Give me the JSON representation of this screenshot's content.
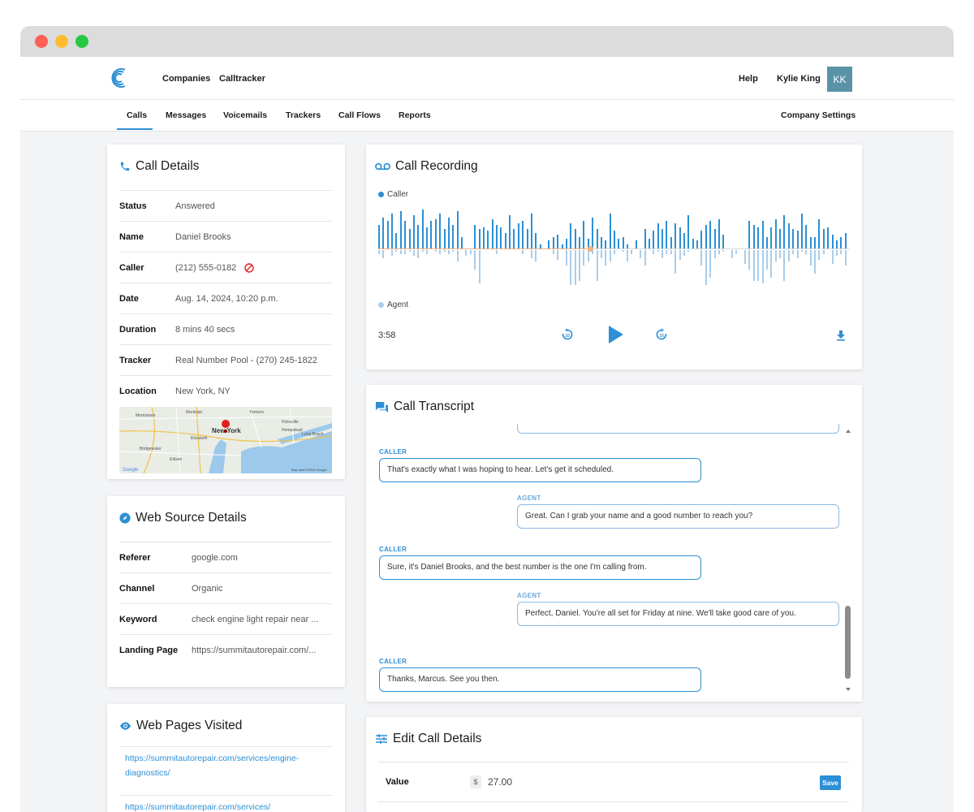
{
  "window": {
    "controls": [
      "close",
      "minimize",
      "maximize"
    ]
  },
  "topnav": {
    "logo_icon": "brand-logo-c-icon",
    "links": [
      "Companies",
      "Calltracker"
    ],
    "help": "Help",
    "user_name": "Kylie King",
    "user_initials": "KK"
  },
  "subnav": {
    "tabs": [
      "Calls",
      "Messages",
      "Voicemails",
      "Trackers",
      "Call Flows",
      "Reports"
    ],
    "active_tab": "Calls",
    "settings": "Company Settings"
  },
  "call_details": {
    "title": "Call Details",
    "icon": "phone-icon",
    "rows": [
      {
        "key": "Status",
        "value": "Answered"
      },
      {
        "key": "Name",
        "value": "Daniel Brooks"
      },
      {
        "key": "Caller",
        "value": "(212) 555-0182"
      },
      {
        "key": "Date",
        "value": "Aug. 14, 2024, 10:20 p.m."
      },
      {
        "key": "Duration",
        "value": "8 mins 40 secs"
      },
      {
        "key": "Tracker",
        "value": "Real Number Pool - (270) 245-1822"
      },
      {
        "key": "Location",
        "value": "New York, NY"
      }
    ],
    "map": {
      "city_label": "New York",
      "labels": [
        "Morristown",
        "Montclair",
        "Yonkers",
        "Hicksville",
        "Elizabeth",
        "Hempstead",
        "Bridgewater",
        "Edison",
        "Long Beach"
      ],
      "attribution": "Map data ©2026 Google",
      "brand": "Google"
    }
  },
  "web_source": {
    "title": "Web Source Details",
    "icon": "compass-icon",
    "rows": [
      {
        "key": "Referer",
        "value": "google.com"
      },
      {
        "key": "Channel",
        "value": "Organic"
      },
      {
        "key": "Keyword",
        "value": "check engine light repair near ..."
      },
      {
        "key": "Landing Page",
        "value": "https://summitautorepair.com/..."
      }
    ]
  },
  "pages_visited": {
    "title": "Web Pages Visited",
    "icon": "eye-icon",
    "pages": [
      "https://summitautorepair.com/services/engine-diagnostics/",
      "https://summitautorepair.com/services/"
    ]
  },
  "recording": {
    "title": "Call Recording",
    "icon": "voicemail-icon",
    "legend_caller": "Caller",
    "legend_agent": "Agent",
    "time": "3:58",
    "colors": {
      "caller": "#2d8fd5",
      "agent": "#a9cdea",
      "progress": "#f4b183"
    },
    "caller_levels": [
      0.6,
      0.8,
      0.7,
      0.9,
      0.4,
      0.95,
      0.7,
      0.5,
      0.85,
      0.6,
      1.0,
      0.55,
      0.7,
      0.75,
      0.9,
      0.5,
      0.8,
      0.6,
      0.95,
      0.3,
      0,
      0,
      0.6,
      0.5,
      0.55,
      0.45,
      0.75,
      0.6,
      0.55,
      0.4,
      0.85,
      0.5,
      0.65,
      0.7,
      0.5,
      0.9,
      0.4,
      0.1,
      0,
      0.2,
      0.3,
      0.35,
      0.1,
      0.25,
      0.65,
      0.5,
      0.3,
      0.7,
      0.25,
      0.8,
      0.5,
      0.3,
      0.2,
      0.9,
      0.45,
      0.25,
      0.3,
      0.1,
      0,
      0.2,
      0,
      0.5,
      0.25,
      0.45,
      0.65,
      0.5,
      0.7,
      0.3,
      0.65,
      0.55,
      0.4,
      0.85,
      0.25,
      0.2,
      0.45,
      0.6,
      0.7,
      0.5,
      0.75,
      0.35,
      0,
      0,
      0,
      0,
      0,
      0.7,
      0.6,
      0.55,
      0.7,
      0.3,
      0.55,
      0.75,
      0.5,
      0.85,
      0.65,
      0.5,
      0.45,
      0.9,
      0.6,
      0.3,
      0.3,
      0.75,
      0.5,
      0.55,
      0.35,
      0.2,
      0.3,
      0.4
    ],
    "agent_levels": [
      0.1,
      0.2,
      0,
      0.15,
      0.05,
      0.1,
      0.1,
      0.05,
      0.15,
      0.2,
      0.05,
      0.1,
      0,
      0.05,
      0.1,
      0.05,
      0.1,
      0.05,
      0.3,
      0,
      0.15,
      0.1,
      0.5,
      0.85,
      0,
      0,
      0,
      0.1,
      0,
      0,
      0,
      0,
      0,
      0.1,
      0,
      0.2,
      0.3,
      0,
      0,
      0,
      0.1,
      0.25,
      0,
      0.4,
      0.9,
      0.9,
      0.8,
      0.4,
      0.3,
      0.1,
      0.8,
      0.2,
      0.4,
      0.3,
      0.1,
      0,
      0.05,
      0.3,
      0.1,
      0,
      0.2,
      0.4,
      0,
      0.1,
      0.05,
      0.2,
      0.1,
      0.1,
      0.6,
      0.25,
      0.15,
      0.05,
      0,
      0,
      0.4,
      0.9,
      0.7,
      0.2,
      0.1,
      0.05,
      0,
      0.2,
      0.1,
      0,
      0.35,
      0.5,
      0.8,
      0.8,
      0.85,
      0.5,
      0.7,
      0.3,
      0.2,
      0.8,
      0.3,
      0.1,
      0.2,
      0.05,
      0.1,
      0.4,
      0.6,
      0.25,
      0.1,
      0,
      0.35,
      0.15,
      0.1,
      0.4,
      0.3
    ],
    "progress_fraction": 0.45
  },
  "transcript": {
    "title": "Call Transcript",
    "icon": "chat-icon",
    "messages": [
      {
        "speaker": "CALLER",
        "text": "That's exactly what I was hoping to hear. Let's get it scheduled."
      },
      {
        "speaker": "AGENT",
        "text": "Great. Can I grab your name and a good number to reach you?"
      },
      {
        "speaker": "CALLER",
        "text": "Sure, it's Daniel Brooks, and the best number is the one I'm calling from."
      },
      {
        "speaker": "AGENT",
        "text": "Perfect, Daniel. You're all set for Friday at nine. We'll take good care of you."
      },
      {
        "speaker": "CALLER",
        "text": "Thanks, Marcus. See you then."
      }
    ]
  },
  "edit_details": {
    "title": "Edit Call Details",
    "icon": "sliders-icon",
    "value_label": "Value",
    "currency_symbol": "$",
    "value": "27.00",
    "save_label": "Save"
  }
}
